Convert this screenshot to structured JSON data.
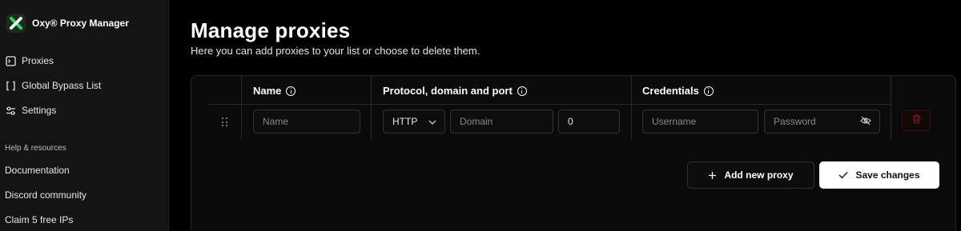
{
  "sidebar": {
    "brand": "Oxy® Proxy Manager",
    "nav": [
      {
        "label": "Proxies",
        "icon": "terminal-icon"
      },
      {
        "label": "Global Bypass List",
        "icon": "brackets-icon"
      },
      {
        "label": "Settings",
        "icon": "sliders-icon"
      }
    ],
    "resources_title": "Help & resources",
    "resources": [
      {
        "label": "Documentation"
      },
      {
        "label": "Discord community"
      },
      {
        "label": "Claim 5 free IPs"
      }
    ]
  },
  "main": {
    "title": "Manage proxies",
    "subtitle": "Here you can add proxies to your list or choose to delete them.",
    "table": {
      "columns": [
        {
          "label": "Name",
          "icon": "info-icon"
        },
        {
          "label": "Protocol, domain and port",
          "icon": "info-icon"
        },
        {
          "label": "Credentials",
          "icon": "info-icon"
        }
      ],
      "row": {
        "name_placeholder": "Name",
        "protocol_value": "HTTP",
        "domain_placeholder": "Domain",
        "port_value": "0",
        "username_placeholder": "Username",
        "password_placeholder": "Password"
      }
    },
    "actions": {
      "add_label": "Add new proxy",
      "save_label": "Save changes"
    }
  },
  "colors": {
    "background": "#000000",
    "sidebar": "#141414",
    "logo_green": "#2fd46b",
    "delete_red": "#8b1c1c"
  }
}
